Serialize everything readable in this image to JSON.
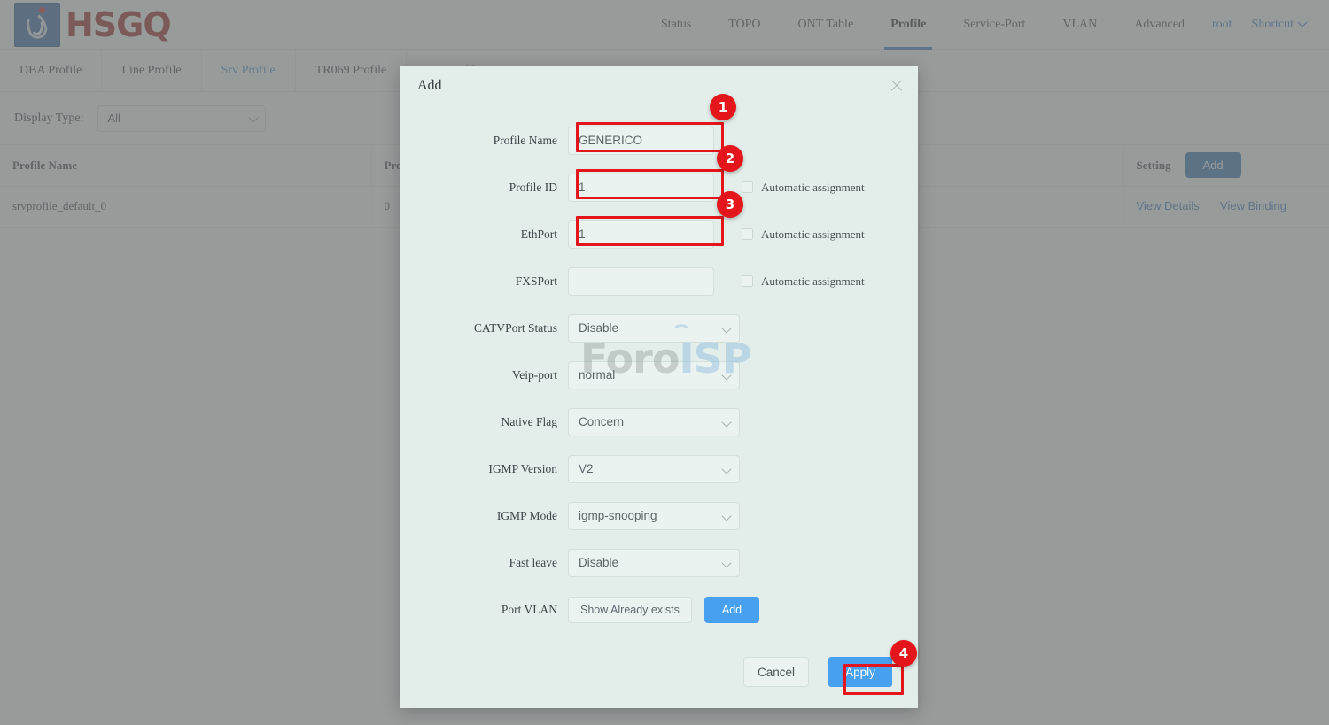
{
  "header": {
    "brand": "HSGQ",
    "logo_icon": "hsgq-droplet-logo",
    "nav": [
      {
        "label": "Status",
        "active": false
      },
      {
        "label": "TOPO",
        "active": false
      },
      {
        "label": "ONT Table",
        "active": false
      },
      {
        "label": "Profile",
        "active": true
      },
      {
        "label": "Service-Port",
        "active": false
      },
      {
        "label": "VLAN",
        "active": false
      },
      {
        "label": "Advanced",
        "active": false
      }
    ],
    "user": "root",
    "shortcut": "Shortcut"
  },
  "tabs": [
    {
      "label": "DBA Profile",
      "active": false
    },
    {
      "label": "Line Profile",
      "active": false
    },
    {
      "label": "Srv Profile",
      "active": true
    },
    {
      "label": "TR069 Profile",
      "active": false
    },
    {
      "label": "SIP Profile",
      "active": false
    }
  ],
  "filter": {
    "label": "Display Type:",
    "value": "All"
  },
  "table": {
    "columns": [
      "Profile Name",
      "Profile ID",
      "Setting"
    ],
    "add_button": "Add",
    "rows": [
      {
        "profile_name": "srvprofile_default_0",
        "profile_id": "0",
        "actions": [
          "View Details",
          "View Binding"
        ]
      }
    ]
  },
  "modal": {
    "title": "Add",
    "close_icon": "close-icon",
    "fields": {
      "profile_name": {
        "label": "Profile Name",
        "value": "GENERICO"
      },
      "profile_id": {
        "label": "Profile ID",
        "value": "1",
        "auto": "Automatic assignment"
      },
      "ethport": {
        "label": "EthPort",
        "value": "1",
        "auto": "Automatic assignment"
      },
      "fxsport": {
        "label": "FXSPort",
        "value": "",
        "auto": "Automatic assignment"
      },
      "catvport_status": {
        "label": "CATVPort Status",
        "value": "Disable"
      },
      "veip_port": {
        "label": "Veip-port",
        "value": "normal"
      },
      "native_flag": {
        "label": "Native Flag",
        "value": "Concern"
      },
      "igmp_version": {
        "label": "IGMP Version",
        "value": "V2"
      },
      "igmp_mode": {
        "label": "IGMP Mode",
        "value": "igmp-snooping"
      },
      "fast_leave": {
        "label": "Fast leave",
        "value": "Disable"
      },
      "port_vlan": {
        "label": "Port VLAN",
        "show_button": "Show Already exists",
        "add_button": "Add"
      }
    },
    "footer": {
      "cancel": "Cancel",
      "apply": "Apply"
    }
  },
  "annotations": {
    "badges": [
      "1",
      "2",
      "3",
      "4"
    ],
    "color": "#e4151b"
  },
  "watermark": {
    "part1": "Foro",
    "part2": "ISP"
  }
}
